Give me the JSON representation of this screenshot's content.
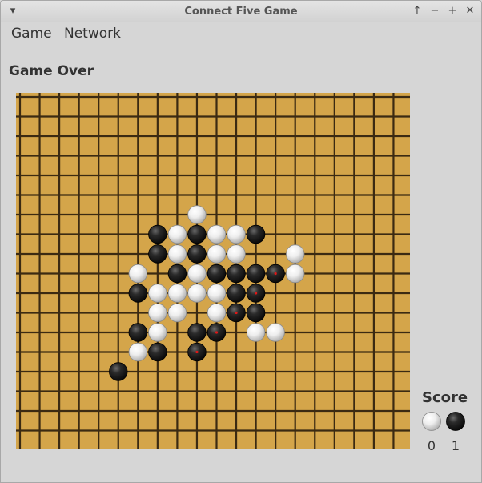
{
  "window": {
    "title": "Connect Five Game",
    "controls": [
      "up-arrow",
      "minimize",
      "maximize",
      "close"
    ]
  },
  "menu": {
    "items": [
      "Game",
      "Network"
    ]
  },
  "status": {
    "text": "Game Over"
  },
  "board": {
    "background": "#d4a54a",
    "line_color": "#3b2a12",
    "columns": 20,
    "rows": 18,
    "white_stones": [
      [
        9,
        6
      ],
      [
        8,
        7
      ],
      [
        10,
        7
      ],
      [
        11,
        7
      ],
      [
        8,
        8
      ],
      [
        10,
        8
      ],
      [
        11,
        8
      ],
      [
        14,
        8
      ],
      [
        6,
        9
      ],
      [
        9,
        9
      ],
      [
        14,
        9
      ],
      [
        7,
        10
      ],
      [
        8,
        10
      ],
      [
        9,
        10
      ],
      [
        10,
        10
      ],
      [
        7,
        11
      ],
      [
        8,
        11
      ],
      [
        10,
        11
      ],
      [
        7,
        12
      ],
      [
        12,
        12
      ],
      [
        13,
        12
      ],
      [
        6,
        13
      ]
    ],
    "black_stones": [
      [
        7,
        7
      ],
      [
        9,
        7
      ],
      [
        12,
        7
      ],
      [
        7,
        8
      ],
      [
        9,
        8
      ],
      [
        8,
        9
      ],
      [
        10,
        9
      ],
      [
        11,
        9
      ],
      [
        12,
        9
      ],
      [
        13,
        9
      ],
      [
        6,
        10
      ],
      [
        11,
        10
      ],
      [
        12,
        10
      ],
      [
        11,
        11
      ],
      [
        12,
        11
      ],
      [
        6,
        12
      ],
      [
        9,
        12
      ],
      [
        10,
        12
      ],
      [
        7,
        13
      ],
      [
        9,
        13
      ],
      [
        5,
        14
      ]
    ],
    "marked_stones": [
      [
        13,
        9
      ],
      [
        12,
        10
      ],
      [
        11,
        11
      ],
      [
        10,
        12
      ],
      [
        9,
        13
      ]
    ]
  },
  "score": {
    "title": "Score",
    "white": "0",
    "black": "1"
  }
}
